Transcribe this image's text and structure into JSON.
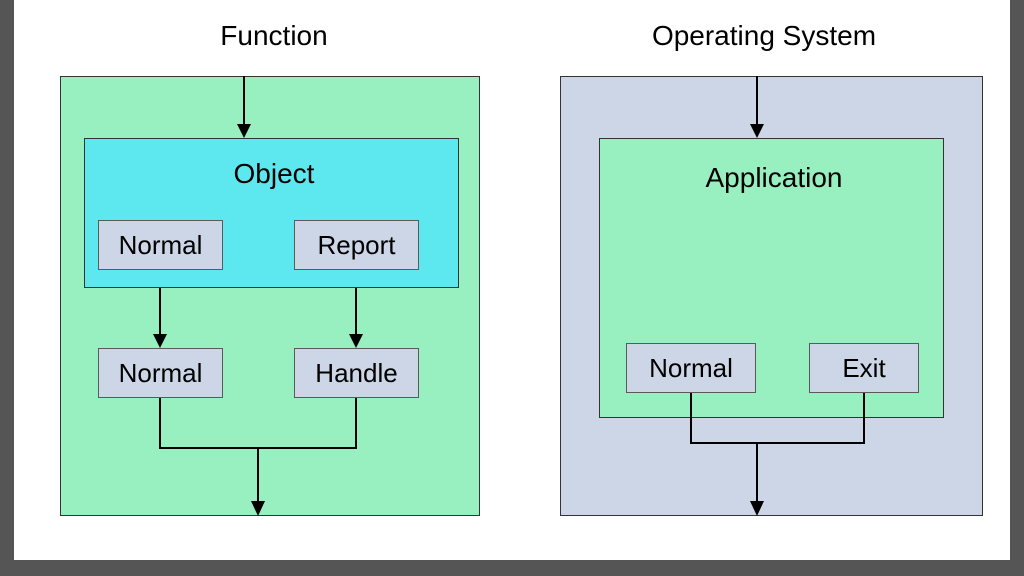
{
  "left": {
    "title": "Function",
    "object_label": "Object",
    "row1": {
      "left": "Normal",
      "right": "Report"
    },
    "row2": {
      "left": "Normal",
      "right": "Handle"
    }
  },
  "right": {
    "title": "Operating System",
    "app_label": "Application",
    "row": {
      "left": "Normal",
      "right": "Exit"
    }
  },
  "colors": {
    "page_bg": "#555",
    "sheet_bg": "#fff",
    "mint": "#98f0c0",
    "cyan": "#5de7ee",
    "blue": "#cdd6e6"
  }
}
